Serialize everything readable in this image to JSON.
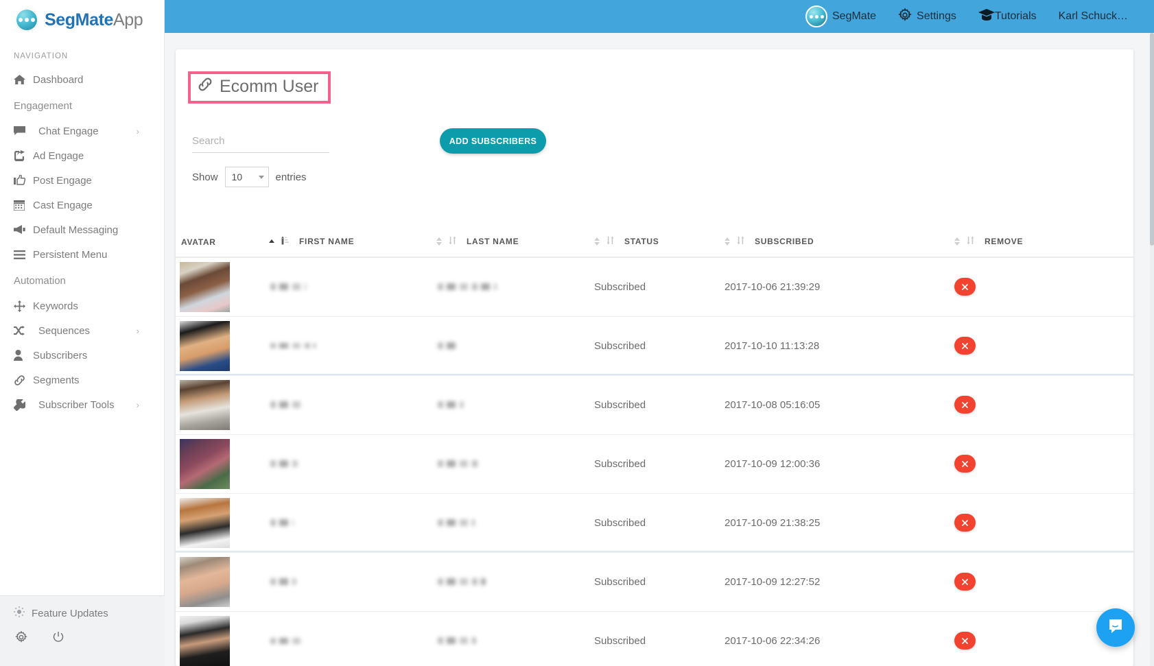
{
  "brand": {
    "name_bold": "SegMate",
    "name_light": "App",
    "logo_icon": "segmate-logo-icon"
  },
  "sidebar": {
    "nav_heading": "NAVIGATION",
    "items": [
      {
        "label": "Dashboard",
        "icon": "home-icon",
        "type": "item",
        "chevron": false,
        "indent": false
      },
      {
        "label": "Engagement",
        "icon": "",
        "type": "group"
      },
      {
        "label": "Chat Engage",
        "icon": "comment-icon",
        "type": "item",
        "chevron": true,
        "indent": true
      },
      {
        "label": "Ad Engage",
        "icon": "share-icon",
        "type": "item",
        "chevron": false,
        "indent": false
      },
      {
        "label": "Post Engage",
        "icon": "thumbs-up-icon",
        "type": "item",
        "chevron": false,
        "indent": false
      },
      {
        "label": "Cast Engage",
        "icon": "calendar-icon",
        "type": "item",
        "chevron": false,
        "indent": false
      },
      {
        "label": "Default Messaging",
        "icon": "bullhorn-icon",
        "type": "item",
        "chevron": false,
        "indent": false
      },
      {
        "label": "Persistent Menu",
        "icon": "bars-icon",
        "type": "item",
        "chevron": false,
        "indent": false
      },
      {
        "label": "Automation",
        "icon": "",
        "type": "group"
      },
      {
        "label": "Keywords",
        "icon": "arrows-icon",
        "type": "item",
        "chevron": false,
        "indent": false
      },
      {
        "label": "Sequences",
        "icon": "shuffle-icon",
        "type": "item",
        "chevron": true,
        "indent": true
      },
      {
        "label": "Subscribers",
        "icon": "user-icon",
        "type": "item",
        "chevron": false,
        "indent": false
      },
      {
        "label": "Segments",
        "icon": "link-icon",
        "type": "item",
        "chevron": false,
        "indent": false
      },
      {
        "label": "Subscriber Tools",
        "icon": "wrench-icon",
        "type": "item",
        "chevron": true,
        "indent": true
      }
    ],
    "bottom": {
      "feature_updates": "Feature Updates",
      "feature_updates_icon": "sun-icon",
      "settings_icon": "gear-icon",
      "power_icon": "power-icon"
    }
  },
  "topbar": {
    "background": "#42a5dc",
    "items": [
      {
        "label": "SegMate",
        "icon": "segmate-logo-icon"
      },
      {
        "label": "Settings",
        "icon": "gear-icon"
      },
      {
        "label": "Tutorials",
        "icon": "graduation-cap-icon"
      },
      {
        "label": "Karl Schuck…",
        "icon": ""
      }
    ]
  },
  "page": {
    "title": "Ecomm User",
    "title_icon": "link-icon",
    "highlight_color": "#f4628c"
  },
  "controls": {
    "search_placeholder": "Search",
    "search_value": "",
    "add_subscribers_label": "ADD SUBSCRIBERS",
    "add_button_color": "#0d9cac",
    "show_label": "Show",
    "entries_value": "10",
    "entries_label": "entries"
  },
  "table": {
    "columns": [
      {
        "key": "avatar",
        "label": "AVATAR",
        "sorted": true,
        "sort_dir": "asc"
      },
      {
        "key": "first_name",
        "label": "FIRST NAME",
        "sorted": false,
        "sort_dir": ""
      },
      {
        "key": "last_name",
        "label": "LAST NAME",
        "sorted": false,
        "sort_dir": ""
      },
      {
        "key": "status",
        "label": "STATUS",
        "sorted": false,
        "sort_dir": ""
      },
      {
        "key": "subscribed",
        "label": "SUBSCRIBED",
        "sorted": false,
        "sort_dir": ""
      },
      {
        "key": "remove",
        "label": "REMOVE",
        "sorted": false,
        "sort_dir": ""
      }
    ],
    "remove_button_icon": "close-icon",
    "remove_button_color": "#f1432f",
    "rows": [
      {
        "first_name": "",
        "last_name": "",
        "status": "Subscribed",
        "subscribed": "2017-10-06 21:39:29",
        "avatar": "avatar-image"
      },
      {
        "first_name": "",
        "last_name": "",
        "status": "Subscribed",
        "subscribed": "2017-10-10 11:13:28",
        "avatar": "avatar-image"
      },
      {
        "first_name": "",
        "last_name": "",
        "status": "Subscribed",
        "subscribed": "2017-10-08 05:16:05",
        "avatar": "avatar-image"
      },
      {
        "first_name": "",
        "last_name": "",
        "status": "Subscribed",
        "subscribed": "2017-10-09 12:00:36",
        "avatar": "avatar-image"
      },
      {
        "first_name": "",
        "last_name": "",
        "status": "Subscribed",
        "subscribed": "2017-10-09 21:38:25",
        "avatar": "avatar-image"
      },
      {
        "first_name": "",
        "last_name": "",
        "status": "Subscribed",
        "subscribed": "2017-10-09 12:27:52",
        "avatar": "avatar-image"
      },
      {
        "first_name": "",
        "last_name": "",
        "status": "Subscribed",
        "subscribed": "2017-10-06 22:34:26",
        "avatar": "avatar-image"
      }
    ]
  },
  "chat_widget": {
    "icon": "chat-bubble-icon",
    "color": "#1da1f2"
  }
}
